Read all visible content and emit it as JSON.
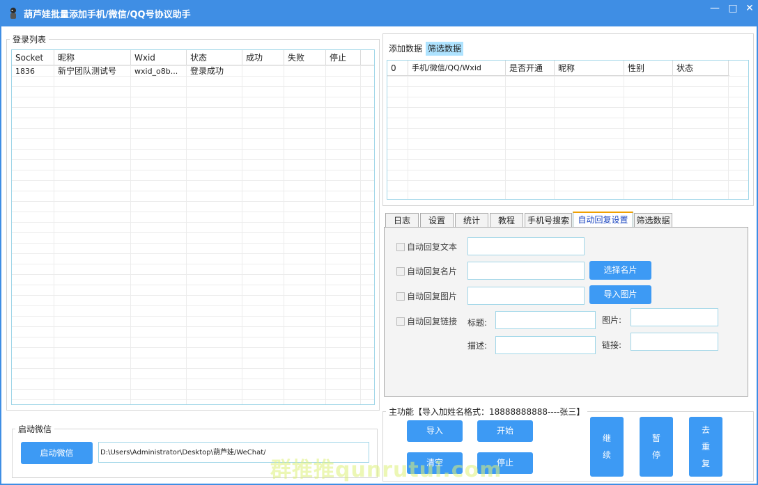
{
  "window": {
    "title": "葫芦娃批量添加手机/微信/QQ号协议助手",
    "minimize": "—",
    "maximize": "□",
    "close": "✕"
  },
  "login_group": {
    "legend": "登录列表",
    "columns": [
      "Socket",
      "昵称",
      "Wxid",
      "状态",
      "成功",
      "失败",
      "停止"
    ],
    "rows": [
      {
        "socket": "1836",
        "nickname": "新宁团队测试号",
        "wxid": "wxid_o8b...",
        "status": "登录成功",
        "success": "",
        "fail": "",
        "stop": ""
      }
    ]
  },
  "start_group": {
    "legend": "启动微信",
    "button": "启动微信",
    "path": "D:\\Users\\Administrator\\Desktop\\葫芦娃/WeChat/"
  },
  "data_tabs": {
    "tabs": [
      "添加数据",
      "筛选数据"
    ],
    "active": 1,
    "columns": [
      "0",
      "手机/微信/QQ/Wxid",
      "是否开通",
      "昵称",
      "性别",
      "状态"
    ]
  },
  "settings_tabs": {
    "tabs": [
      "日志",
      "设置",
      "统计",
      "教程",
      "手机号搜索",
      "自动回复设置",
      "筛选数据"
    ],
    "active": 5
  },
  "auto_reply": {
    "text_label": "自动回复文本",
    "card_label": "自动回复名片",
    "card_button": "选择名片",
    "image_label": "自动回复图片",
    "image_button": "导入图片",
    "link_label": "自动回复链接",
    "link_title": "标题:",
    "link_image": "图片:",
    "link_desc": "描述:",
    "link_url": "链接:"
  },
  "main_group": {
    "legend": "主功能【导入加姓名格式：18888888888----张三】",
    "import": "导入",
    "start": "开始",
    "clear": "清空",
    "stop": "停止",
    "continue_chars": [
      "继",
      "续"
    ],
    "pause_chars": [
      "暂",
      "停"
    ],
    "dedupe_chars": [
      "去",
      "重",
      "复"
    ]
  },
  "watermark": "群推推qunrutui.com",
  "colors": {
    "titlebar": "#3f8ee4",
    "button": "#3d9af4",
    "grid_border": "#a0d6e8",
    "active_tab_top": "#f0a000"
  }
}
